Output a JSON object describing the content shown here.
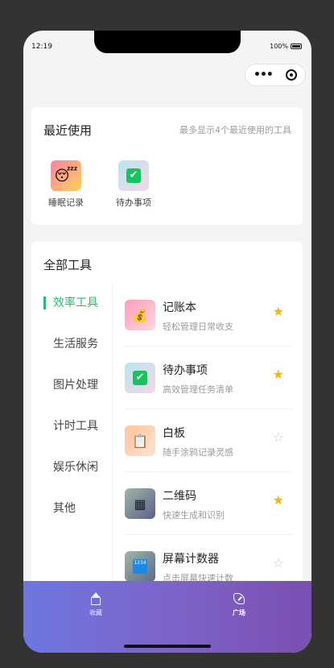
{
  "status_bar": {
    "time": "12:19",
    "battery": "100%"
  },
  "capsule": {
    "more_icon": "more-dots-icon",
    "close_icon": "target-circle-icon"
  },
  "recent": {
    "title": "最近使用",
    "note": "最多显示4个最近使用的工具",
    "items": [
      {
        "label": "睡眠记录",
        "icon": "sleep-face-icon",
        "glyph": "😴",
        "bg": "#ff8a8a"
      },
      {
        "label": "待办事项",
        "icon": "checkbox-icon",
        "glyph": "✔",
        "bg": "#d4ecec"
      }
    ]
  },
  "all_tools": {
    "title": "全部工具",
    "categories": [
      "效率工具",
      "生活服务",
      "图片处理",
      "计时工具",
      "娱乐休闲",
      "其他"
    ],
    "active_category": "效率工具",
    "tools": [
      {
        "name": "记账本",
        "desc": "轻松管理日常收支",
        "icon": "money-bag-icon",
        "glyph": "💰",
        "favorited": true
      },
      {
        "name": "待办事项",
        "desc": "高效管理任务清单",
        "icon": "checkbox-icon",
        "glyph": "✔",
        "favorited": true
      },
      {
        "name": "白板",
        "desc": "随手涂鸦记录灵感",
        "icon": "clipboard-icon",
        "glyph": "📋",
        "favorited": false
      },
      {
        "name": "二维码",
        "desc": "快速生成和识别",
        "icon": "qr-code-icon",
        "glyph": "▦",
        "favorited": true
      },
      {
        "name": "屏幕计数器",
        "desc": "点击屏幕快速计数",
        "icon": "counter-icon",
        "glyph": "1234",
        "favorited": false
      }
    ]
  },
  "tabbar": {
    "tabs": [
      {
        "label": "收藏",
        "icon": "home-icon"
      },
      {
        "label": "广场",
        "icon": "leaf-icon"
      }
    ]
  },
  "colors": {
    "accent": "#1fbf6f",
    "star_on": "#f5b700",
    "star_off": "#c9c9c9"
  }
}
